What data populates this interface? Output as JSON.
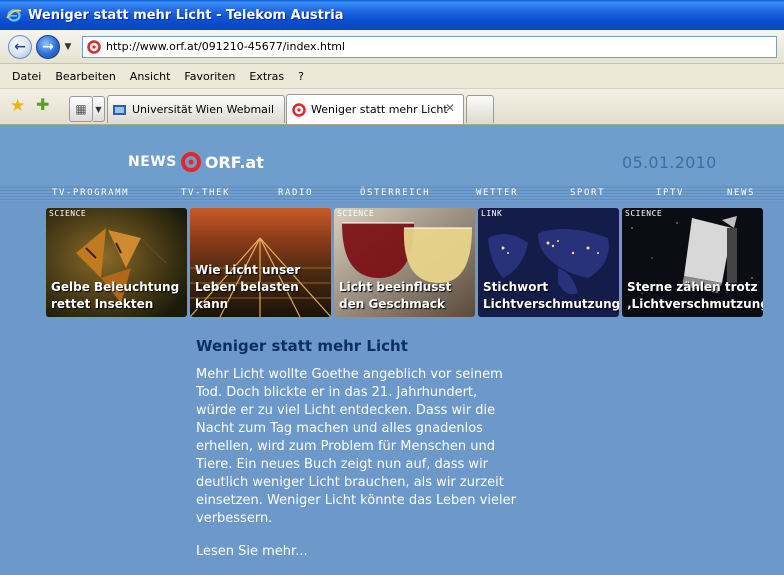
{
  "window": {
    "title": "Weniger statt mehr Licht - Telekom Austria"
  },
  "address_bar": {
    "url": "http://www.orf.at/091210-45677/index.html"
  },
  "menu": {
    "items": [
      "Datei",
      "Bearbeiten",
      "Ansicht",
      "Favoriten",
      "Extras",
      "?"
    ]
  },
  "tabs": [
    {
      "label": "Universität Wien Webmail",
      "active": false
    },
    {
      "label": "Weniger statt mehr Licht",
      "active": true
    }
  ],
  "site": {
    "logo_news": "NEWS",
    "logo_orf": "ORF.at",
    "date": "05.01.2010",
    "nav": [
      "TV-PROGRAMM",
      "TV-THEK",
      "RADIO",
      "ÖSTERREICH",
      "WETTER",
      "SPORT",
      "IPTV",
      "NEWS"
    ]
  },
  "teasers": [
    {
      "tag": "SCIENCE",
      "caption": "Gelbe Beleuchtung rettet Insekten"
    },
    {
      "tag": "",
      "caption": "Wie Licht unser Leben belasten kann"
    },
    {
      "tag": "SCIENCE",
      "caption": "Licht beeinflusst den Geschmack"
    },
    {
      "tag": "LINK",
      "caption": "Stichwort Lichtverschmutzung"
    },
    {
      "tag": "SCIENCE",
      "caption": "Sterne zählen trotz ‚Lichtverschmutzung‘"
    }
  ],
  "article": {
    "headline": "Weniger statt mehr Licht",
    "body": "Mehr Licht wollte Goethe angeblich vor seinem\nTod. Doch blickte er in das 21. Jahrhundert,\nwürde er zu viel Licht entdecken. Dass wir die\nNacht zum Tag machen und alles gnadenlos\nerhellen, wird zum Problem für Menschen und\nTiere. Ein neues Buch zeigt nun auf, dass wir\ndeutlich weniger Licht brauchen, als wir zurzeit\neinsetzen. Weniger Licht könnte das Leben vieler\nverbessern.",
    "more_link": "Lesen Sie mehr..."
  },
  "colors": {
    "page_bg": "#6c99ca",
    "headline": "#0b2f5e",
    "date": "#3e6da5",
    "orf_red": "#e0282a"
  }
}
